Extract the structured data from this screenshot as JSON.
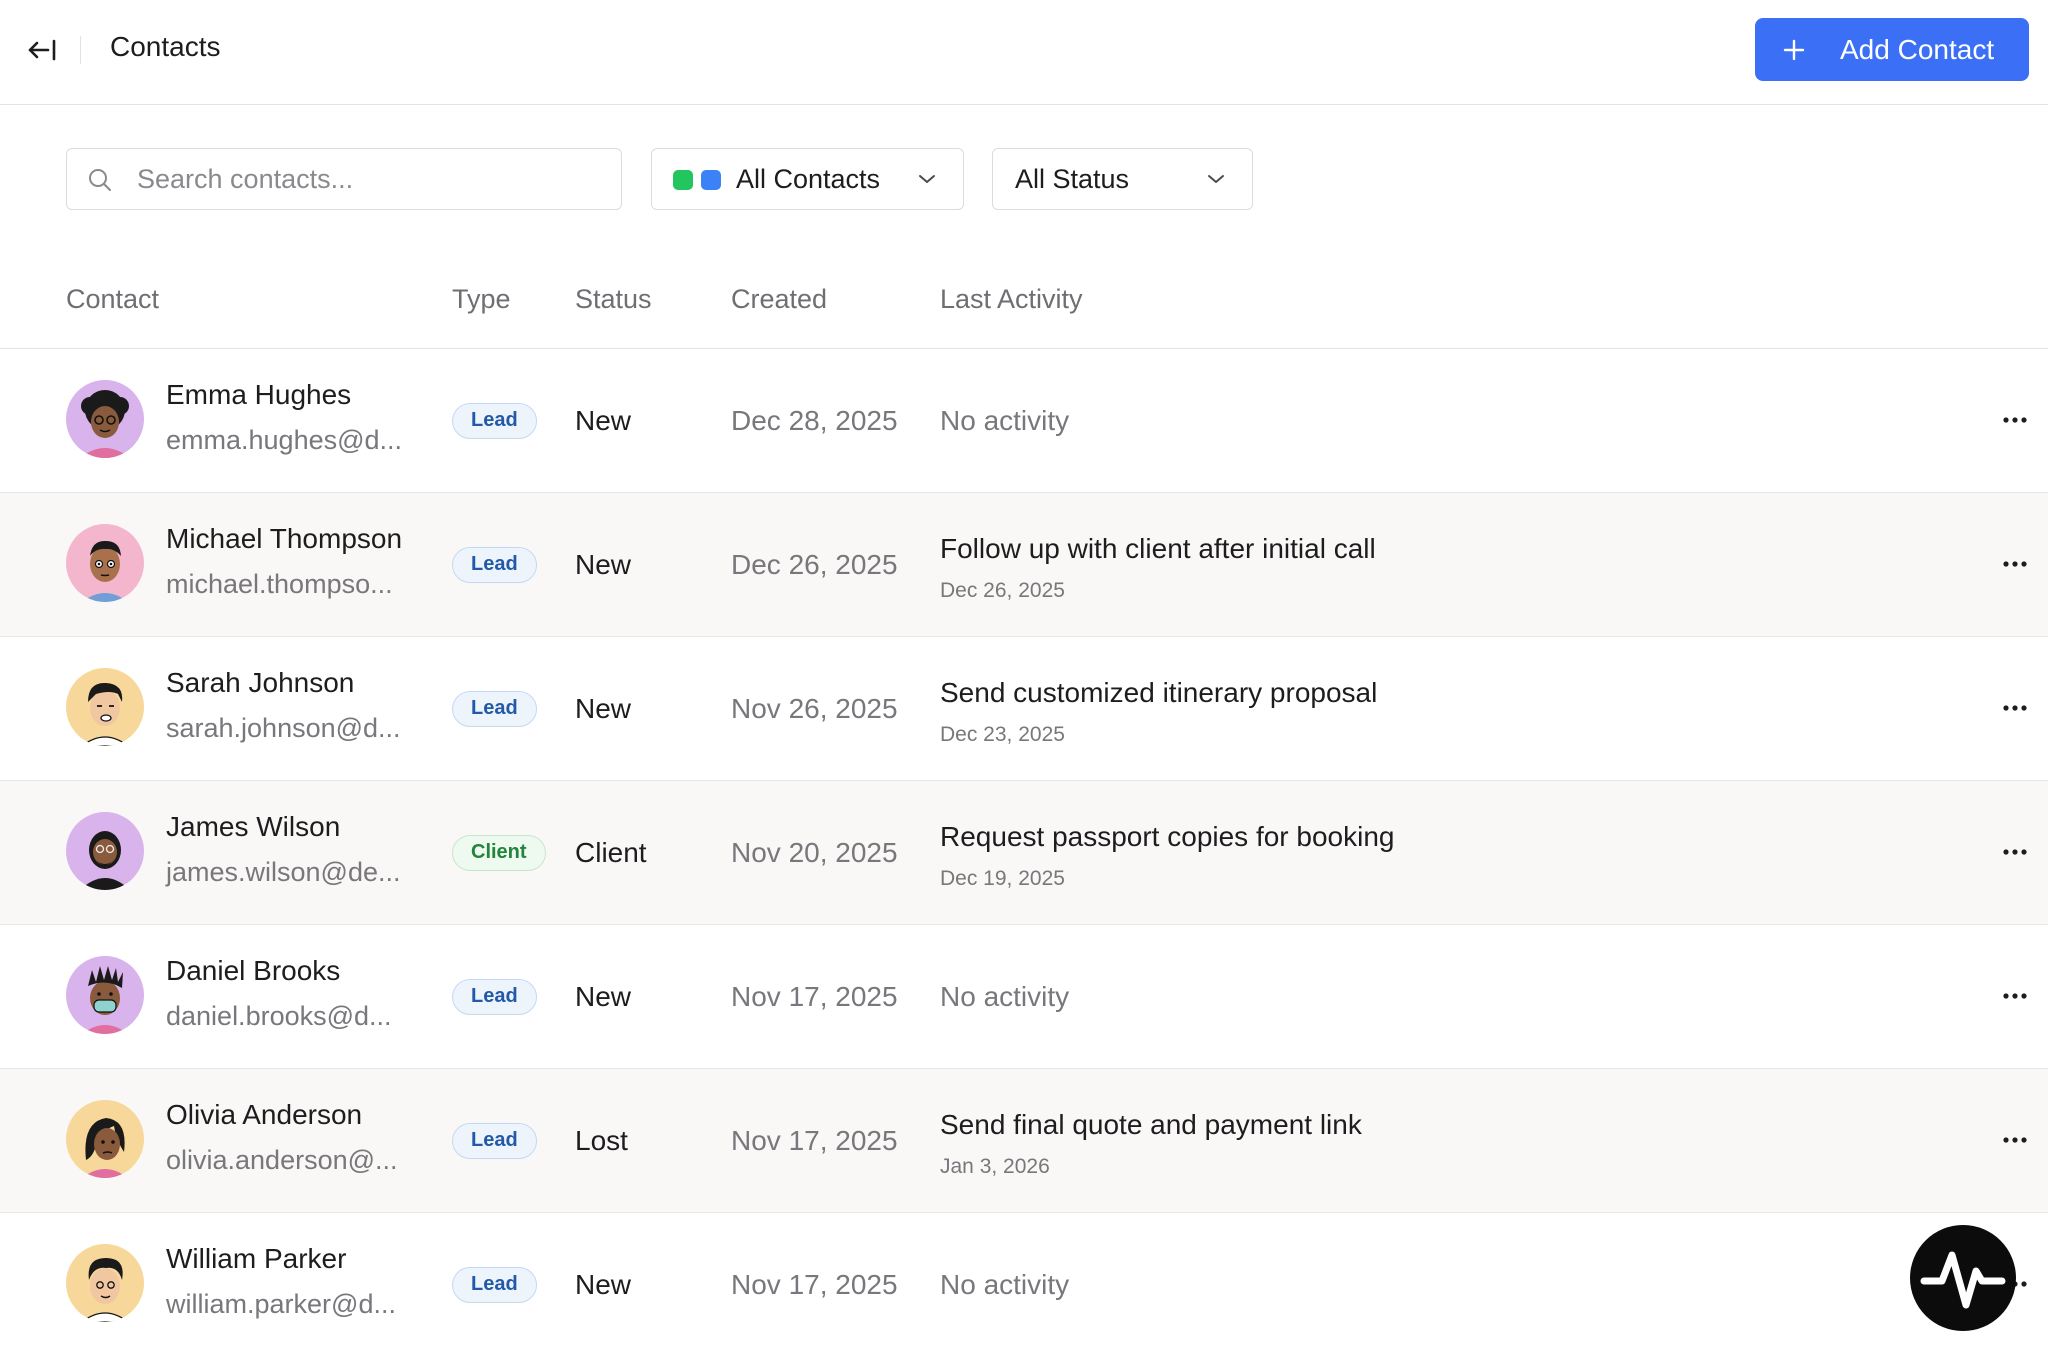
{
  "header": {
    "title": "Contacts",
    "add_button_label": "Add Contact",
    "accent_color": "#3b6ff5"
  },
  "filters": {
    "search_placeholder": "Search contacts...",
    "contacts_filter": "All Contacts",
    "status_filter": "All Status"
  },
  "table": {
    "columns": [
      "Contact",
      "Type",
      "Status",
      "Created",
      "Last Activity"
    ],
    "rows": [
      {
        "name": "Emma Hughes",
        "email": "emma.hughes@d...",
        "type": "Lead",
        "status": "New",
        "created": "Dec 28, 2025",
        "activity": "No activity",
        "activity_date": ""
      },
      {
        "name": "Michael Thompson",
        "email": "michael.thompso...",
        "type": "Lead",
        "status": "New",
        "created": "Dec 26, 2025",
        "activity": "Follow up with client after initial call",
        "activity_date": "Dec 26, 2025"
      },
      {
        "name": "Sarah Johnson",
        "email": "sarah.johnson@d...",
        "type": "Lead",
        "status": "New",
        "created": "Nov 26, 2025",
        "activity": "Send customized itinerary proposal",
        "activity_date": "Dec 23, 2025"
      },
      {
        "name": "James Wilson",
        "email": "james.wilson@de...",
        "type": "Client",
        "status": "Client",
        "created": "Nov 20, 2025",
        "activity": "Request passport copies for booking",
        "activity_date": "Dec 19, 2025"
      },
      {
        "name": "Daniel Brooks",
        "email": "daniel.brooks@d...",
        "type": "Lead",
        "status": "New",
        "created": "Nov 17, 2025",
        "activity": "No activity",
        "activity_date": ""
      },
      {
        "name": "Olivia Anderson",
        "email": "olivia.anderson@...",
        "type": "Lead",
        "status": "Lost",
        "created": "Nov 17, 2025",
        "activity": "Send final quote and payment link",
        "activity_date": "Jan 3, 2026"
      },
      {
        "name": "William Parker",
        "email": "william.parker@d...",
        "type": "Lead",
        "status": "New",
        "created": "Nov 17, 2025",
        "activity": "No activity",
        "activity_date": ""
      }
    ]
  }
}
